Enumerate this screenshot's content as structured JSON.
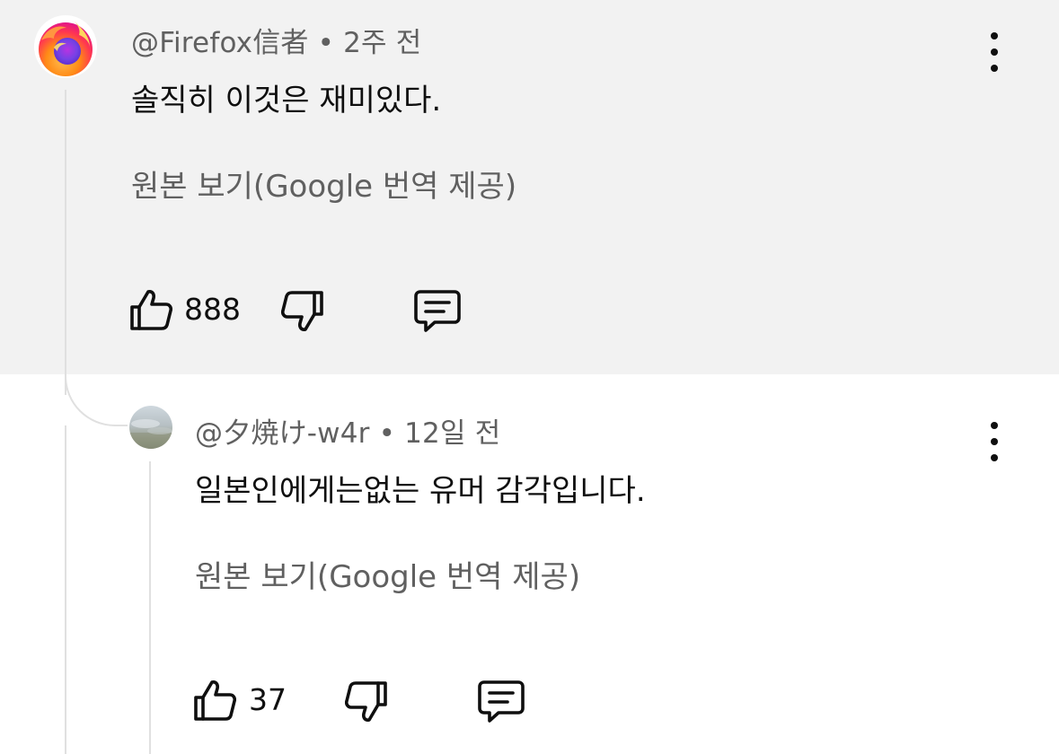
{
  "comments": [
    {
      "author": "@Firefox信者",
      "separator": "•",
      "time": "2주 전",
      "text": "솔직히 이것은 재미있다.",
      "translate_link": "원본 보기(Google 번역 제공)",
      "likes": "888",
      "avatar_icon": "firefox-logo-icon",
      "highlighted": true
    },
    {
      "author": "@夕焼け-w4r",
      "separator": "•",
      "time": "12일 전",
      "text": "일본인에게는없는 유머 감각입니다.",
      "translate_link": "원본 보기(Google 번역 제공)",
      "likes": "37",
      "avatar_icon": "sky-photo-avatar",
      "highlighted": false
    }
  ],
  "icons": {
    "like": "thumbs-up-icon",
    "dislike": "thumbs-down-icon",
    "reply": "reply-comment-icon",
    "menu": "kebab-menu-icon"
  },
  "colors": {
    "highlight_bg": "#f2f2f2",
    "secondary_text": "#606060",
    "primary_text": "#0f0f0f",
    "thread_line": "#e0e0e0"
  }
}
